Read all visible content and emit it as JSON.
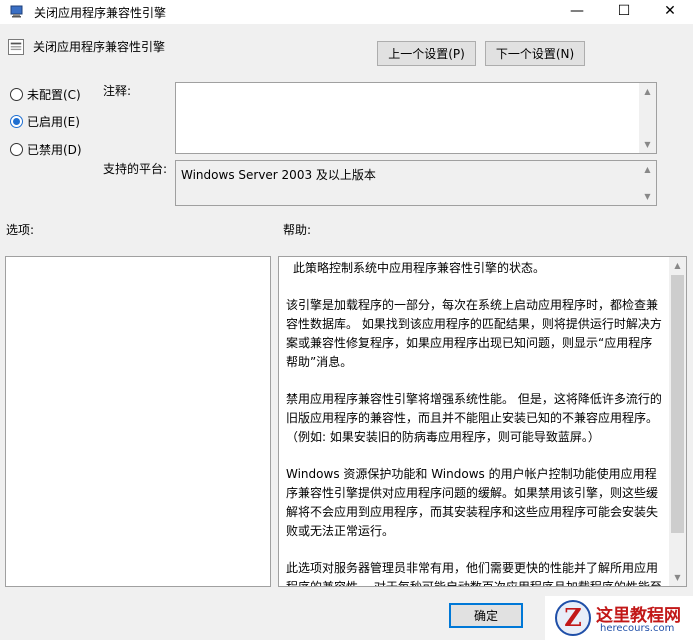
{
  "window": {
    "title": "关闭应用程序兼容性引擎",
    "minimize": "—",
    "maximize": "☐",
    "close": "✕"
  },
  "header": {
    "setting_title": "关闭应用程序兼容性引擎",
    "prev_button": "上一个设置(P)",
    "next_button": "下一个设置(N)"
  },
  "state": {
    "options": [
      {
        "label": "未配置(C)",
        "selected": false
      },
      {
        "label": "已启用(E)",
        "selected": true
      },
      {
        "label": "已禁用(D)",
        "selected": false
      }
    ]
  },
  "comment": {
    "label": "注释:",
    "value": ""
  },
  "platform": {
    "label": "支持的平台:",
    "value": "Windows Server 2003 及以上版本"
  },
  "options_section": {
    "label": "选项:"
  },
  "help_section": {
    "label": "帮助:",
    "paragraphs": [
      "此策略控制系统中应用程序兼容性引擎的状态。",
      "该引擎是加载程序的一部分，每次在系统上启动应用程序时，都检查兼容性数据库。 如果找到该应用程序的匹配结果，则将提供运行时解决方案或兼容性修复程序，如果应用程序出现已知问题，则显示“应用程序帮助”消息。",
      "禁用应用程序兼容性引擎将增强系统性能。 但是，这将降低许多流行的旧版应用程序的兼容性，而且并不能阻止安装已知的不兼容应用程序。（例如: 如果安装旧的防病毒应用程序，则可能导致蓝屏。）",
      "Windows 资源保护功能和 Windows 的用户帐户控制功能使用应用程序兼容性引擎提供对应用程序问题的缓解。如果禁用该引擎，则这些缓解将不会应用到应用程序，而其安装程序和这些应用程序可能会安装失败或无法正常运行。",
      "此选项对服务器管理员非常有用，他们需要更快的性能并了解所用应用程序的兼容性。 对于每秒可能启动数百次应用程序且加载程序的性能至关重要的 Web 服务器，该选项尤其有用。"
    ]
  },
  "footer": {
    "ok_button": "确定"
  },
  "watermark": {
    "logo_letter": "Z",
    "site_name": "这里教程网",
    "url": "herecours.com"
  }
}
